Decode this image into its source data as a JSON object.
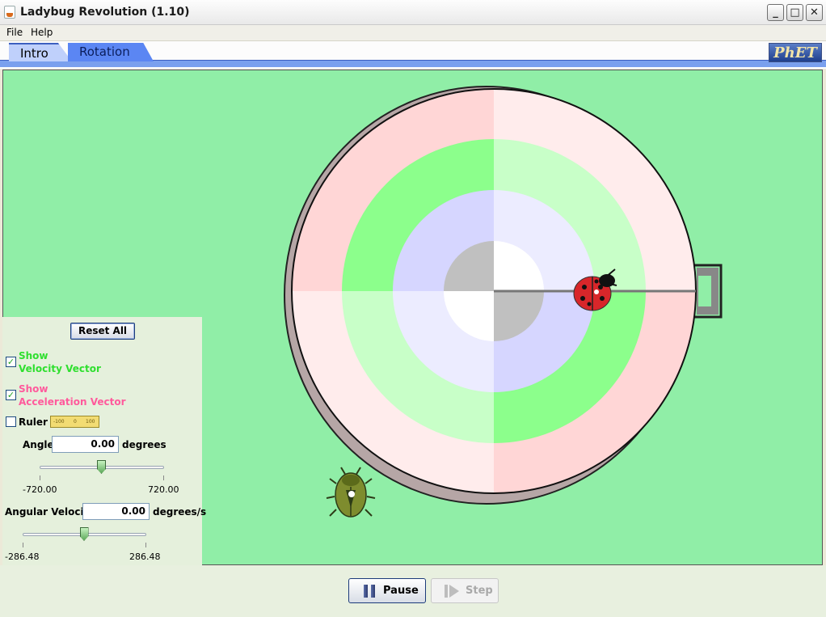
{
  "window": {
    "title": "Ladybug Revolution (1.10)"
  },
  "menu": {
    "file": "File",
    "help": "Help"
  },
  "tabs": [
    {
      "label": "Intro",
      "selected": true
    },
    {
      "label": "Rotation",
      "selected": false
    }
  ],
  "logo": {
    "text": "PhET"
  },
  "controls": {
    "reset_label": "Reset All",
    "velocity": {
      "checked": true,
      "line1": "Show",
      "line2": "Velocity Vector",
      "color": "#2fdf2f"
    },
    "acceleration": {
      "checked": true,
      "line1": "Show",
      "line2": "Acceleration Vector",
      "color": "#ff5a9c"
    },
    "ruler": {
      "checked": false,
      "label": "Ruler",
      "ticks": [
        "-100",
        "0",
        "100"
      ]
    },
    "angle": {
      "label": "Angle",
      "value": "0.00",
      "units": "degrees",
      "min": "-720.00",
      "max": "720.00",
      "slider_fraction": 0.5
    },
    "angular_velocity": {
      "label": "Angular Velocity",
      "value": "0.00",
      "units": "degrees/s",
      "min": "-286.48",
      "max": "286.48",
      "slider_fraction": 0.5
    }
  },
  "buttons": {
    "pause": "Pause",
    "step": "Step",
    "step_enabled": false
  },
  "colors": {
    "play_area_bg": "#90eea7",
    "panel_bg": "#e5f0dc",
    "ring_outer": [
      "#ffd6d6",
      "#ffecec"
    ],
    "ring_green": [
      "#8cff8c",
      "#c8ffc8"
    ],
    "ring_blue": [
      "#d6d6ff",
      "#ececff"
    ],
    "ring_center": [
      "#c0c0c0",
      "#ffffff"
    ]
  }
}
